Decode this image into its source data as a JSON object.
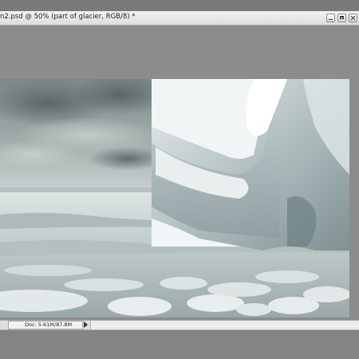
{
  "window": {
    "title": "n2.psd @ 50% (part of glacier, RGB/8) *"
  },
  "status": {
    "doc_info": "Doc: 5.61M/87.8M"
  },
  "colors": {
    "workspace": "#8c8c8c",
    "titlebar": "#e6e6e6",
    "statusbar": "#dedede"
  },
  "icons": [
    "minimize-icon",
    "maximize-icon",
    "close-icon",
    "status-menu-arrow-icon"
  ]
}
